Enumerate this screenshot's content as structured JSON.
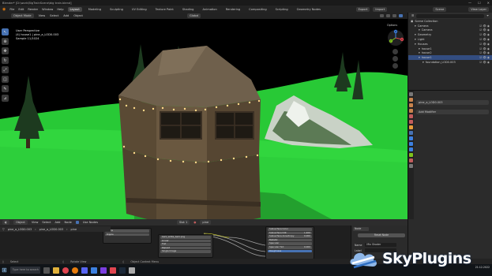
{
  "window_title": "Blender* [D:\\work\\BigTrainScene\\big train.blend]",
  "window_controls": [
    "—",
    "☐",
    "✕"
  ],
  "menu": [
    "File",
    "Edit",
    "Render",
    "Window",
    "Help"
  ],
  "workspaces": [
    "Layout",
    "Modeling",
    "Sculpting",
    "UV Editing",
    "Texture Paint",
    "Shading",
    "Animation",
    "Rendering",
    "Compositing",
    "Scripting",
    "Geometry Nodes"
  ],
  "active_workspace": "Layout",
  "topright": {
    "export": "Export",
    "import": "Import",
    "scene": "Scene",
    "view_layer": "View Layer"
  },
  "viewport": {
    "mode": "Object Mode",
    "menus": [
      "View",
      "Select",
      "Add",
      "Object"
    ],
    "orientation": "Global",
    "info": [
      "User Perspective",
      "(4) house1 | pine_a_LOD0.003",
      "Sample 11/1024"
    ],
    "options": "Options"
  },
  "gizmo_axes": {
    "x": "X",
    "y": "Y",
    "z": "Z"
  },
  "outliner": {
    "title": "Scene Collection",
    "rows": [
      {
        "label": "Camera",
        "indent": 1,
        "sel": false
      },
      {
        "label": "Camera",
        "indent": 2,
        "sel": false
      },
      {
        "label": "Geometry",
        "indent": 1,
        "sel": false
      },
      {
        "label": "Light",
        "indent": 1,
        "sel": false
      },
      {
        "label": "Houses",
        "indent": 1,
        "sel": false
      },
      {
        "label": "house1",
        "indent": 2,
        "sel": false
      },
      {
        "label": "house2",
        "indent": 2,
        "sel": false
      },
      {
        "label": "house1",
        "indent": 2,
        "sel": true
      },
      {
        "label": "foundation_LOD0.003",
        "indent": 3,
        "sel": false
      }
    ]
  },
  "properties": {
    "object": "pine_a_LOD0.003",
    "add_modifier": "Add Modifier"
  },
  "node_editor": {
    "menus": [
      "View",
      "Select",
      "Add",
      "Node"
    ],
    "use_nodes": "Use Nodes",
    "slot": "Slot 1",
    "material": "pine",
    "object": "pine_a_LOD0.003",
    "nodes": {
      "left_fields": [
        "Alpha",
        "Ripple"
      ],
      "image_node": "bark_white_bark.png",
      "image_fields": [
        "Linear",
        "Flat",
        "Repeat",
        "Single Image"
      ],
      "bsdf_fields": [
        "Subsurface Color",
        "Subsurface IOR",
        "Subsurface Anisotropy",
        "Metallic",
        "Specular",
        "Specular Tint",
        "Roughness"
      ],
      "bsdf_values": [
        "",
        "1.400",
        "0.000",
        "",
        "",
        "0.000",
        ""
      ]
    }
  },
  "node_panel": {
    "tab": "Node",
    "reset": "Reset Node",
    "name_label": "Name",
    "name_value": "Mix Shader",
    "label_label": "Label"
  },
  "statusbar": [
    "Select",
    "Rotate View",
    "Object Context Menu"
  ],
  "taskbar": {
    "search": "Type here to search",
    "time": "21:12.2022"
  },
  "logo": "SkyPlugins",
  "colors": {
    "accent": "#4772b3",
    "selection": "#334d80",
    "grass": "#2fd13a",
    "sky": "#000000"
  }
}
